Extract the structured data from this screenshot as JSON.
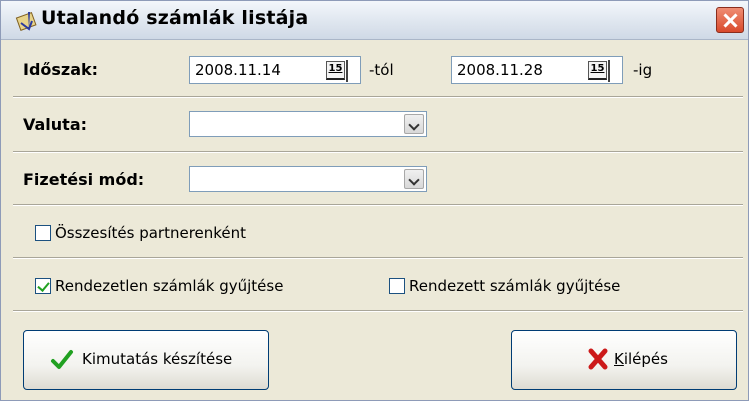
{
  "window": {
    "title": "Utalandó számlák listája"
  },
  "period": {
    "label": "Időszak:",
    "from_value": "2008.11.14",
    "from_suffix": "-tól",
    "to_value": "2008.11.28",
    "to_suffix": "-ig",
    "calendar_glyph": "15"
  },
  "currency": {
    "label": "Valuta:",
    "value": ""
  },
  "payment_method": {
    "label": "Fizetési mód:",
    "value": ""
  },
  "options": {
    "summary_per_partner": {
      "label": "Összesítés partnerenként",
      "checked": false
    },
    "unsettled_invoices": {
      "label": "Rendezetlen számlák gyűjtése",
      "checked": true
    },
    "settled_invoices": {
      "label": "Rendezett számlák gyűjtése",
      "checked": false
    }
  },
  "buttons": {
    "create_report": "Kimutatás készítése",
    "exit": "Kilépés"
  },
  "colors": {
    "check_green": "#21a121",
    "exit_red": "#cc1a1a"
  },
  "icons": {
    "create_report": "checkmark-icon",
    "exit": "red-x-icon",
    "title": "money-icon"
  }
}
